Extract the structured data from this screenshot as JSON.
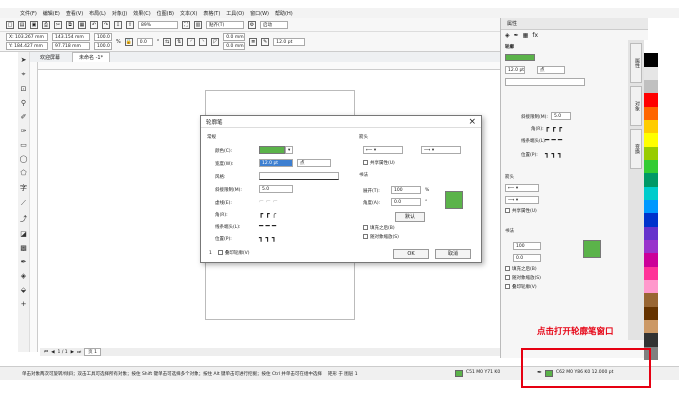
{
  "menu": [
    "文件(F)",
    "编辑(E)",
    "查看(V)",
    "布局(L)",
    "对象(J)",
    "效果(C)",
    "位图(B)",
    "文本(X)",
    "表格(T)",
    "工具(O)",
    "窗口(W)",
    "帮助(H)"
  ],
  "toolbar": {
    "zoom": "89%",
    "snap": "贴齐(T)",
    "launch": "启动"
  },
  "propbar": {
    "x": "X: 103.267 mm",
    "y": "Y: 184.427 mm",
    "w": "143.154 mm",
    "h": "97.718 mm",
    "sx": "100.0",
    "sy": "100.0",
    "pct": "%",
    "angle": "0.0",
    "deg": "°",
    "nudge1": "0.0 mm",
    "nudge2": "0.0 mm",
    "outline": "12.0 pt"
  },
  "tabs": {
    "welcome": "欢迎屏幕",
    "doc": "未命名 -1*"
  },
  "dialog": {
    "title": "轮廓笔",
    "close": "×",
    "section_outline": "常规",
    "label_color": "颜色(C):",
    "label_width": "宽度(W):",
    "width_value": "12.0 pt",
    "width_unit": "点",
    "label_style": "风格:",
    "label_miter": "斜接限制(M):",
    "miter_value": "5.0",
    "label_dash": "虚线(E):",
    "label_corner": "角(R):",
    "label_linecap": "线条端头(L):",
    "label_position": "位置(P):",
    "section_arrow": "箭头",
    "share_attr": "共享属性(U)",
    "section_calli": "书法",
    "label_stretch": "展开(T):",
    "stretch_value": "100",
    "stretch_unit": "%",
    "label_angle": "角度(A):",
    "angle_value": "0.0",
    "angle_unit": "°",
    "default_btn": "默认",
    "behind_fill": "填充之后(B)",
    "scale_image": "随对象缩放(S)",
    "page_count": "1",
    "overprint": "叠印轮廓(V)",
    "ok": "OK",
    "cancel": "取消"
  },
  "docker": {
    "title": "属性",
    "section": "轮廓",
    "width": "12.0 pt",
    "unit": "点",
    "miter_label": "斜接限制(M):",
    "miter_value": "5.0",
    "corner_label": "角(R):",
    "linecap_label": "线条端头(L):",
    "position_label": "位置(P):",
    "arrow_label": "箭头",
    "share_attr": "共享属性(U)",
    "calli_label": "书法",
    "stretch_value": "100",
    "angle_value": "0.0",
    "behind_fill": "填充之后(B)",
    "scale_image": "随对象缩放(S)",
    "overprint": "叠印轮廓(V)",
    "vtab1": "属性",
    "vtab2": "对象",
    "vtab3": "变换"
  },
  "pagenav": {
    "page_of": "1 / 1",
    "page_label": "页 1"
  },
  "status": {
    "hint": "单击对象两次可旋转/倾斜；双击工具可选择所有对象；按住 Shift 键单击可选择多个对象；按住 Alt 键单击可进行挖掘；按住 Ctrl 并单击可在组中选择",
    "layer": "矩形 于 图层 1",
    "fill": "C51 M0 Y71 K0",
    "outline": "C62 M0 Y86 K0  12.000 pt"
  },
  "annotation": "点击打开轮廓笔窗口",
  "colors": {
    "accent": "#5bb34a",
    "highlight": "#e60012"
  }
}
